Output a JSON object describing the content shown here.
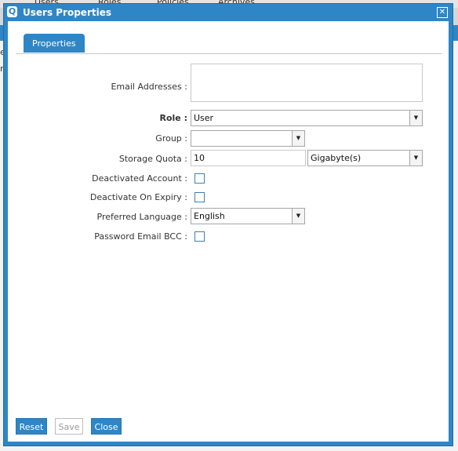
{
  "background": {
    "tabs": [
      "Users",
      "Roles",
      "Policies",
      "Archives"
    ],
    "fragments": [
      "e",
      "r"
    ]
  },
  "dialog": {
    "title": "Users Properties",
    "logo_letter": "Q",
    "close_glyph": "✕",
    "tab": "Properties"
  },
  "form": {
    "email_label": "Email Addresses :",
    "email_value": "",
    "role_label": "Role :",
    "role_value": "User",
    "group_label": "Group :",
    "group_value": "",
    "quota_label": "Storage Quota :",
    "quota_value": "10",
    "quota_unit": "Gigabyte(s)",
    "deactivated_label": "Deactivated Account :",
    "deactivated_checked": false,
    "expiry_label": "Deactivate On Expiry :",
    "expiry_checked": false,
    "language_label": "Preferred Language :",
    "language_value": "English",
    "bcc_label": "Password Email BCC :",
    "bcc_checked": false
  },
  "buttons": {
    "reset": "Reset",
    "save": "Save",
    "close": "Close"
  },
  "icons": {
    "dropdown_arrow": "▼"
  },
  "colors": {
    "accent": "#2f86c7",
    "checkbox_border": "#3d7fb8"
  }
}
